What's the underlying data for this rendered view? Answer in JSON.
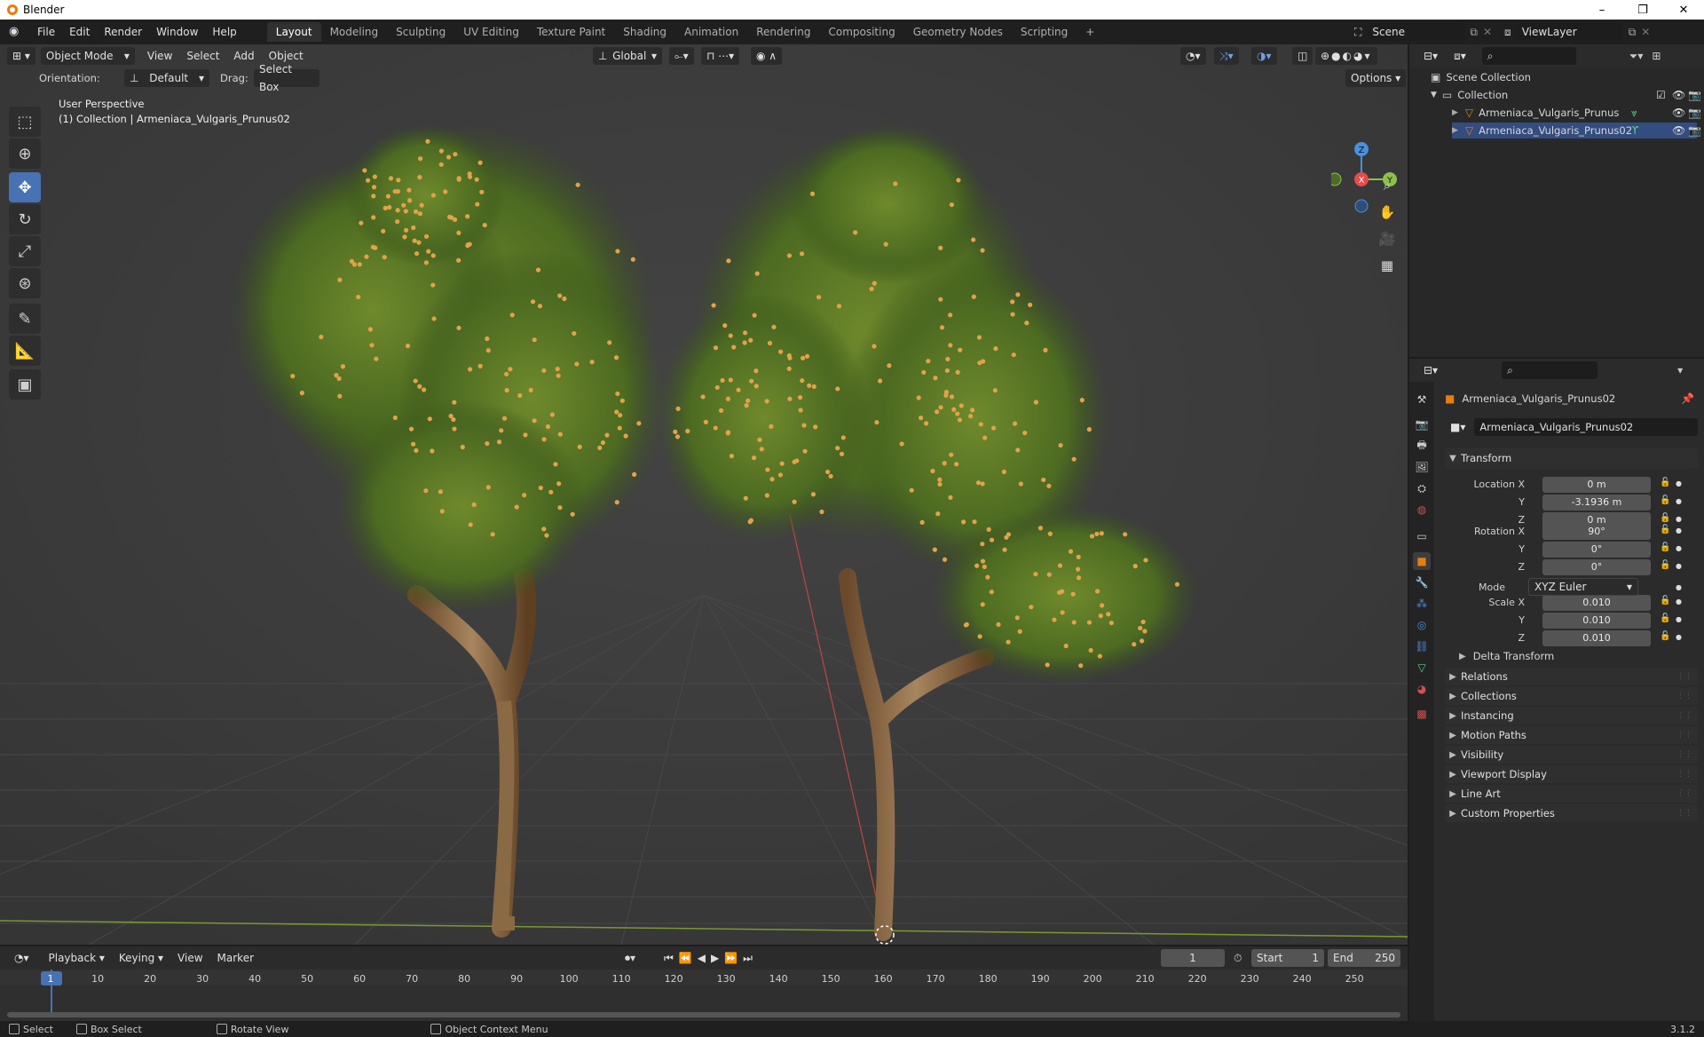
{
  "window": {
    "title": "Blender",
    "min": "–",
    "max": "❐",
    "close": "✕"
  },
  "menu": [
    "File",
    "Edit",
    "Render",
    "Window",
    "Help"
  ],
  "workspaces": [
    "Layout",
    "Modeling",
    "Sculpting",
    "UV Editing",
    "Texture Paint",
    "Shading",
    "Animation",
    "Rendering",
    "Compositing",
    "Geometry Nodes",
    "Scripting"
  ],
  "workspace_add": "+",
  "scene": {
    "name": "Scene",
    "view_layer": "ViewLayer"
  },
  "viewport": {
    "mode": "Object Mode",
    "menus": [
      "View",
      "Select",
      "Add",
      "Object"
    ],
    "transform_orientation": "Global",
    "orientation_label": "Orientation:",
    "orientation_value": "Default",
    "drag_label": "Drag:",
    "drag_value": "Select Box",
    "options": "Options",
    "info_line1": "User Perspective",
    "info_line2": "(1) Collection | Armeniaca_Vulgaris_Prunus02",
    "gizmo": {
      "x": "X",
      "y": "Y",
      "z": "Z"
    }
  },
  "tools": [
    {
      "name": "select-box-tool",
      "icon": "⬚"
    },
    {
      "name": "cursor-tool",
      "icon": "⊕"
    },
    {
      "name": "move-tool",
      "icon": "✥"
    },
    {
      "name": "rotate-tool",
      "icon": "↻"
    },
    {
      "name": "scale-tool",
      "icon": "⤢"
    },
    {
      "name": "transform-tool",
      "icon": "⊛"
    },
    {
      "name": "annotate-tool",
      "icon": "✎"
    },
    {
      "name": "measure-tool",
      "icon": "📐"
    },
    {
      "name": "add-cube-tool",
      "icon": "▣"
    }
  ],
  "outliner": {
    "root": "Scene Collection",
    "collection": "Collection",
    "items": [
      "Armeniaca_Vulgaris_Prunus",
      "Armeniaca_Vulgaris_Prunus02"
    ]
  },
  "properties": {
    "object_name": "Armeniaca_Vulgaris_Prunus02",
    "data_name": "Armeniaca_Vulgaris_Prunus02",
    "transform_title": "Transform",
    "location_label": "Location X",
    "rotation_label": "Rotation X",
    "scale_label": "Scale X",
    "axis_y": "Y",
    "axis_z": "Z",
    "location": [
      "0 m",
      "-3.1936 m",
      "0 m"
    ],
    "rotation": [
      "90°",
      "0°",
      "0°"
    ],
    "mode_label": "Mode",
    "mode_value": "XYZ Euler",
    "scale": [
      "0.010",
      "0.010",
      "0.010"
    ],
    "delta": "Delta Transform",
    "panels": [
      "Relations",
      "Collections",
      "Instancing",
      "Motion Paths",
      "Visibility",
      "Viewport Display",
      "Line Art",
      "Custom Properties"
    ]
  },
  "timeline": {
    "menus": [
      "Playback",
      "Keying",
      "View",
      "Marker"
    ],
    "current_frame": "1",
    "start_label": "Start",
    "start": "1",
    "end_label": "End",
    "end": "250",
    "ticks": [
      "1",
      "10",
      "20",
      "30",
      "40",
      "50",
      "60",
      "70",
      "80",
      "90",
      "100",
      "110",
      "120",
      "130",
      "140",
      "150",
      "160",
      "170",
      "180",
      "190",
      "200",
      "210",
      "220",
      "230",
      "240",
      "250"
    ]
  },
  "status": {
    "select": "Select",
    "box_select": "Box Select",
    "rotate_view": "Rotate View",
    "context_menu": "Object Context Menu",
    "version": "3.1.2"
  },
  "colors": {
    "accent": "#4772b3",
    "x_axis": "#e84b4b",
    "y_axis": "#8bc34a",
    "z_axis": "#4a90e2",
    "orange": "#e87d0d"
  }
}
